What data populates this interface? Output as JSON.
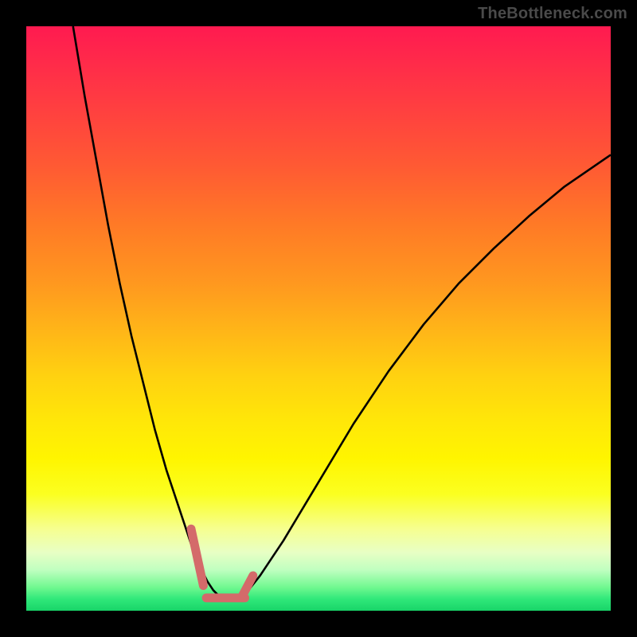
{
  "attribution": "TheBottleneck.com",
  "chart_data": {
    "type": "line",
    "title": "",
    "xlabel": "",
    "ylabel": "",
    "xlim": [
      0,
      100
    ],
    "ylim": [
      0,
      100
    ],
    "series": [
      {
        "name": "black-curve",
        "stroke": "#000000",
        "width": 2.6,
        "x": [
          8,
          10,
          12,
          14,
          16,
          18,
          20,
          22,
          24,
          26,
          27,
          28,
          29,
          30,
          31,
          32,
          33,
          34,
          35,
          36,
          37,
          38,
          40,
          44,
          50,
          56,
          62,
          68,
          74,
          80,
          86,
          92,
          100
        ],
        "y": [
          100,
          88,
          77,
          66,
          56,
          47,
          39,
          31,
          24,
          18,
          15,
          12,
          9,
          7,
          5,
          3.5,
          2.5,
          2,
          2,
          2,
          2.5,
          3.5,
          6,
          12,
          22,
          32,
          41,
          49,
          56,
          62,
          67.5,
          72.5,
          78
        ]
      },
      {
        "name": "pink-marker-left",
        "stroke": "#d46a6a",
        "width": 11,
        "linecap": "round",
        "x": [
          28.2,
          30.3
        ],
        "y": [
          14.0,
          4.3
        ]
      },
      {
        "name": "pink-marker-bottom",
        "stroke": "#d46a6a",
        "width": 11,
        "linecap": "round",
        "x": [
          30.8,
          37.4
        ],
        "y": [
          2.2,
          2.2
        ]
      },
      {
        "name": "pink-marker-right",
        "stroke": "#d46a6a",
        "width": 11,
        "linecap": "round",
        "x": [
          37.0,
          38.8
        ],
        "y": [
          2.6,
          6.0
        ]
      }
    ]
  }
}
